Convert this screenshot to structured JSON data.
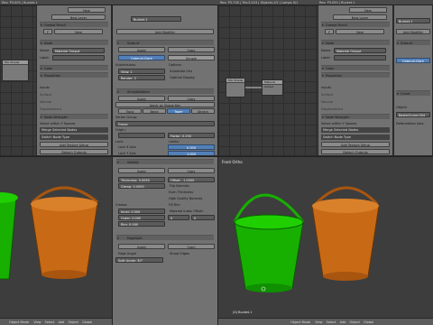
{
  "info": {
    "left": "Rev: P3.005 | Bucket.1",
    "mid": "Rev: P3.718 | Tris:3,024 | Objects:1/2 | Lamps 0/1",
    "right": "Rev: P3.050 | Bucket.1"
  },
  "left_panel": {
    "top": "New",
    "new_layer": "New Layer",
    "material": "Grease Pencil",
    "slot": "F",
    "new": "New",
    "node": "Node",
    "name_label": "Name:",
    "name_value": "Material Output",
    "label_label": "Label:",
    "color": "Color",
    "properties": "Properties",
    "inputs": "Inputs",
    "surface": "Surface",
    "volume": "Volume",
    "displacement": "Displacement",
    "node_wrangler": "Node Wrangler",
    "select_hint": "Select within Y Spaces",
    "merge": "Merge Selected Nodes",
    "switch": "Switch Node Type",
    "add_texture": "Add Texture Setup",
    "detach": "Detach Outputs"
  },
  "right_panel": {
    "top": "New",
    "new_layer": "New Layer",
    "material": "Grease Pencil",
    "slot": "F",
    "new": "New",
    "node": "Node",
    "name_label": "Name:",
    "name_value": "Material Output",
    "label_label": "Label:",
    "color": "Color",
    "properties": "Properties",
    "inputs": "Inputs",
    "surface": "Surface",
    "volume": "Volume",
    "displacement": "Displacement",
    "node_wrangler": "Node Wrangler",
    "select_hint": "Select within Y Spaces",
    "merge": "Merge Selected Nodes",
    "switch": "Switch Node Type",
    "add_texture": "Add Texture Setup",
    "detach": "Detach Outputs"
  },
  "mod_props": {
    "object": "Bucket.1",
    "add_modifier": "Add Modifier",
    "mod1": "Subsurf",
    "apply": "Apply",
    "copy": "Copy",
    "catmull": "Catmull-Clark",
    "simple": "Simple",
    "subdivisions": "Subdivisions:",
    "options": "Options:",
    "view": "View:",
    "view_val": "1",
    "render": "Render:",
    "render_val": "2",
    "subdivide_uvs": "Subdivide UVs",
    "optimal": "Optimal Display",
    "mod2": "SimpleDeform",
    "apply_shape": "Apply as Shape Key",
    "twist": "Twist",
    "bend": "Bend",
    "taper": "Taper",
    "stretch": "Stretch",
    "vgroup": "Vertex Group:",
    "vgroup_val": "Group",
    "origin": "Origin:",
    "factor_label": "Factor:",
    "factor": "0.250",
    "lock": "Lock:",
    "limits": "Limits:",
    "lock_x": "Lock X Axis",
    "lock_y": "Lock Y Axis",
    "limit_a": "0.000",
    "limit_b": "1.000",
    "mod3": "Solidify",
    "thickness_label": "Thickness:",
    "thickness": "0.0050",
    "clamp_label": "Clamp:",
    "clamp": "0.0000",
    "offset_label": "Offset:",
    "offset": "-1.0000",
    "flip": "Flip Normals",
    "even": "Even Thickness",
    "hq": "High Quality Normals",
    "fill_rim": "Fill Rim",
    "crease": "Crease:",
    "inner_label": "Inner:",
    "inner": "0.000",
    "outer_label": "Outer:",
    "outer": "0.000",
    "rim_label": "Rim:",
    "rim": "0.000",
    "mat_offset": "Material Index Offset:",
    "mat_val": "0",
    "rim_val": "0",
    "mod4": "EdgeSplit",
    "edge_angle": "Edge Angle",
    "sharp": "Sharp Edges",
    "split_label": "Split Angle:",
    "split": "30°",
    "right_object": "Bucket.1",
    "right_add": "Add Modifier",
    "right_mod": "Subsurf",
    "right_catmull": "Catmull-Clark",
    "right_simple": "Simple",
    "right_mod2": "Curve",
    "right_object_label": "Object:",
    "right_object_val": "BezierCurve.004",
    "right_deform": "Deformation Axis:"
  },
  "nodes": {
    "n1": "Mix Shader",
    "n2": "Material Output",
    "n3": "Mix Shader"
  },
  "viewport": {
    "label": "Front Ortho",
    "obj": "(0) Bucket.1",
    "mode": "Object Mode",
    "view": "View",
    "select": "Select",
    "add": "Add",
    "object": "Object",
    "global": "Global"
  },
  "left_bottom": {
    "mode": "Object Mode",
    "view": "View",
    "select": "Select",
    "add": "Add",
    "object": "Object",
    "global": "Global"
  },
  "right_bottom": {
    "mode": "Object Mode",
    "view": "View",
    "select": "Select",
    "add": "Add",
    "object": "Object",
    "global": "Global"
  },
  "colors": {
    "green": "#17b000",
    "orange": "#c86a15",
    "highlight": "#5480b8"
  }
}
